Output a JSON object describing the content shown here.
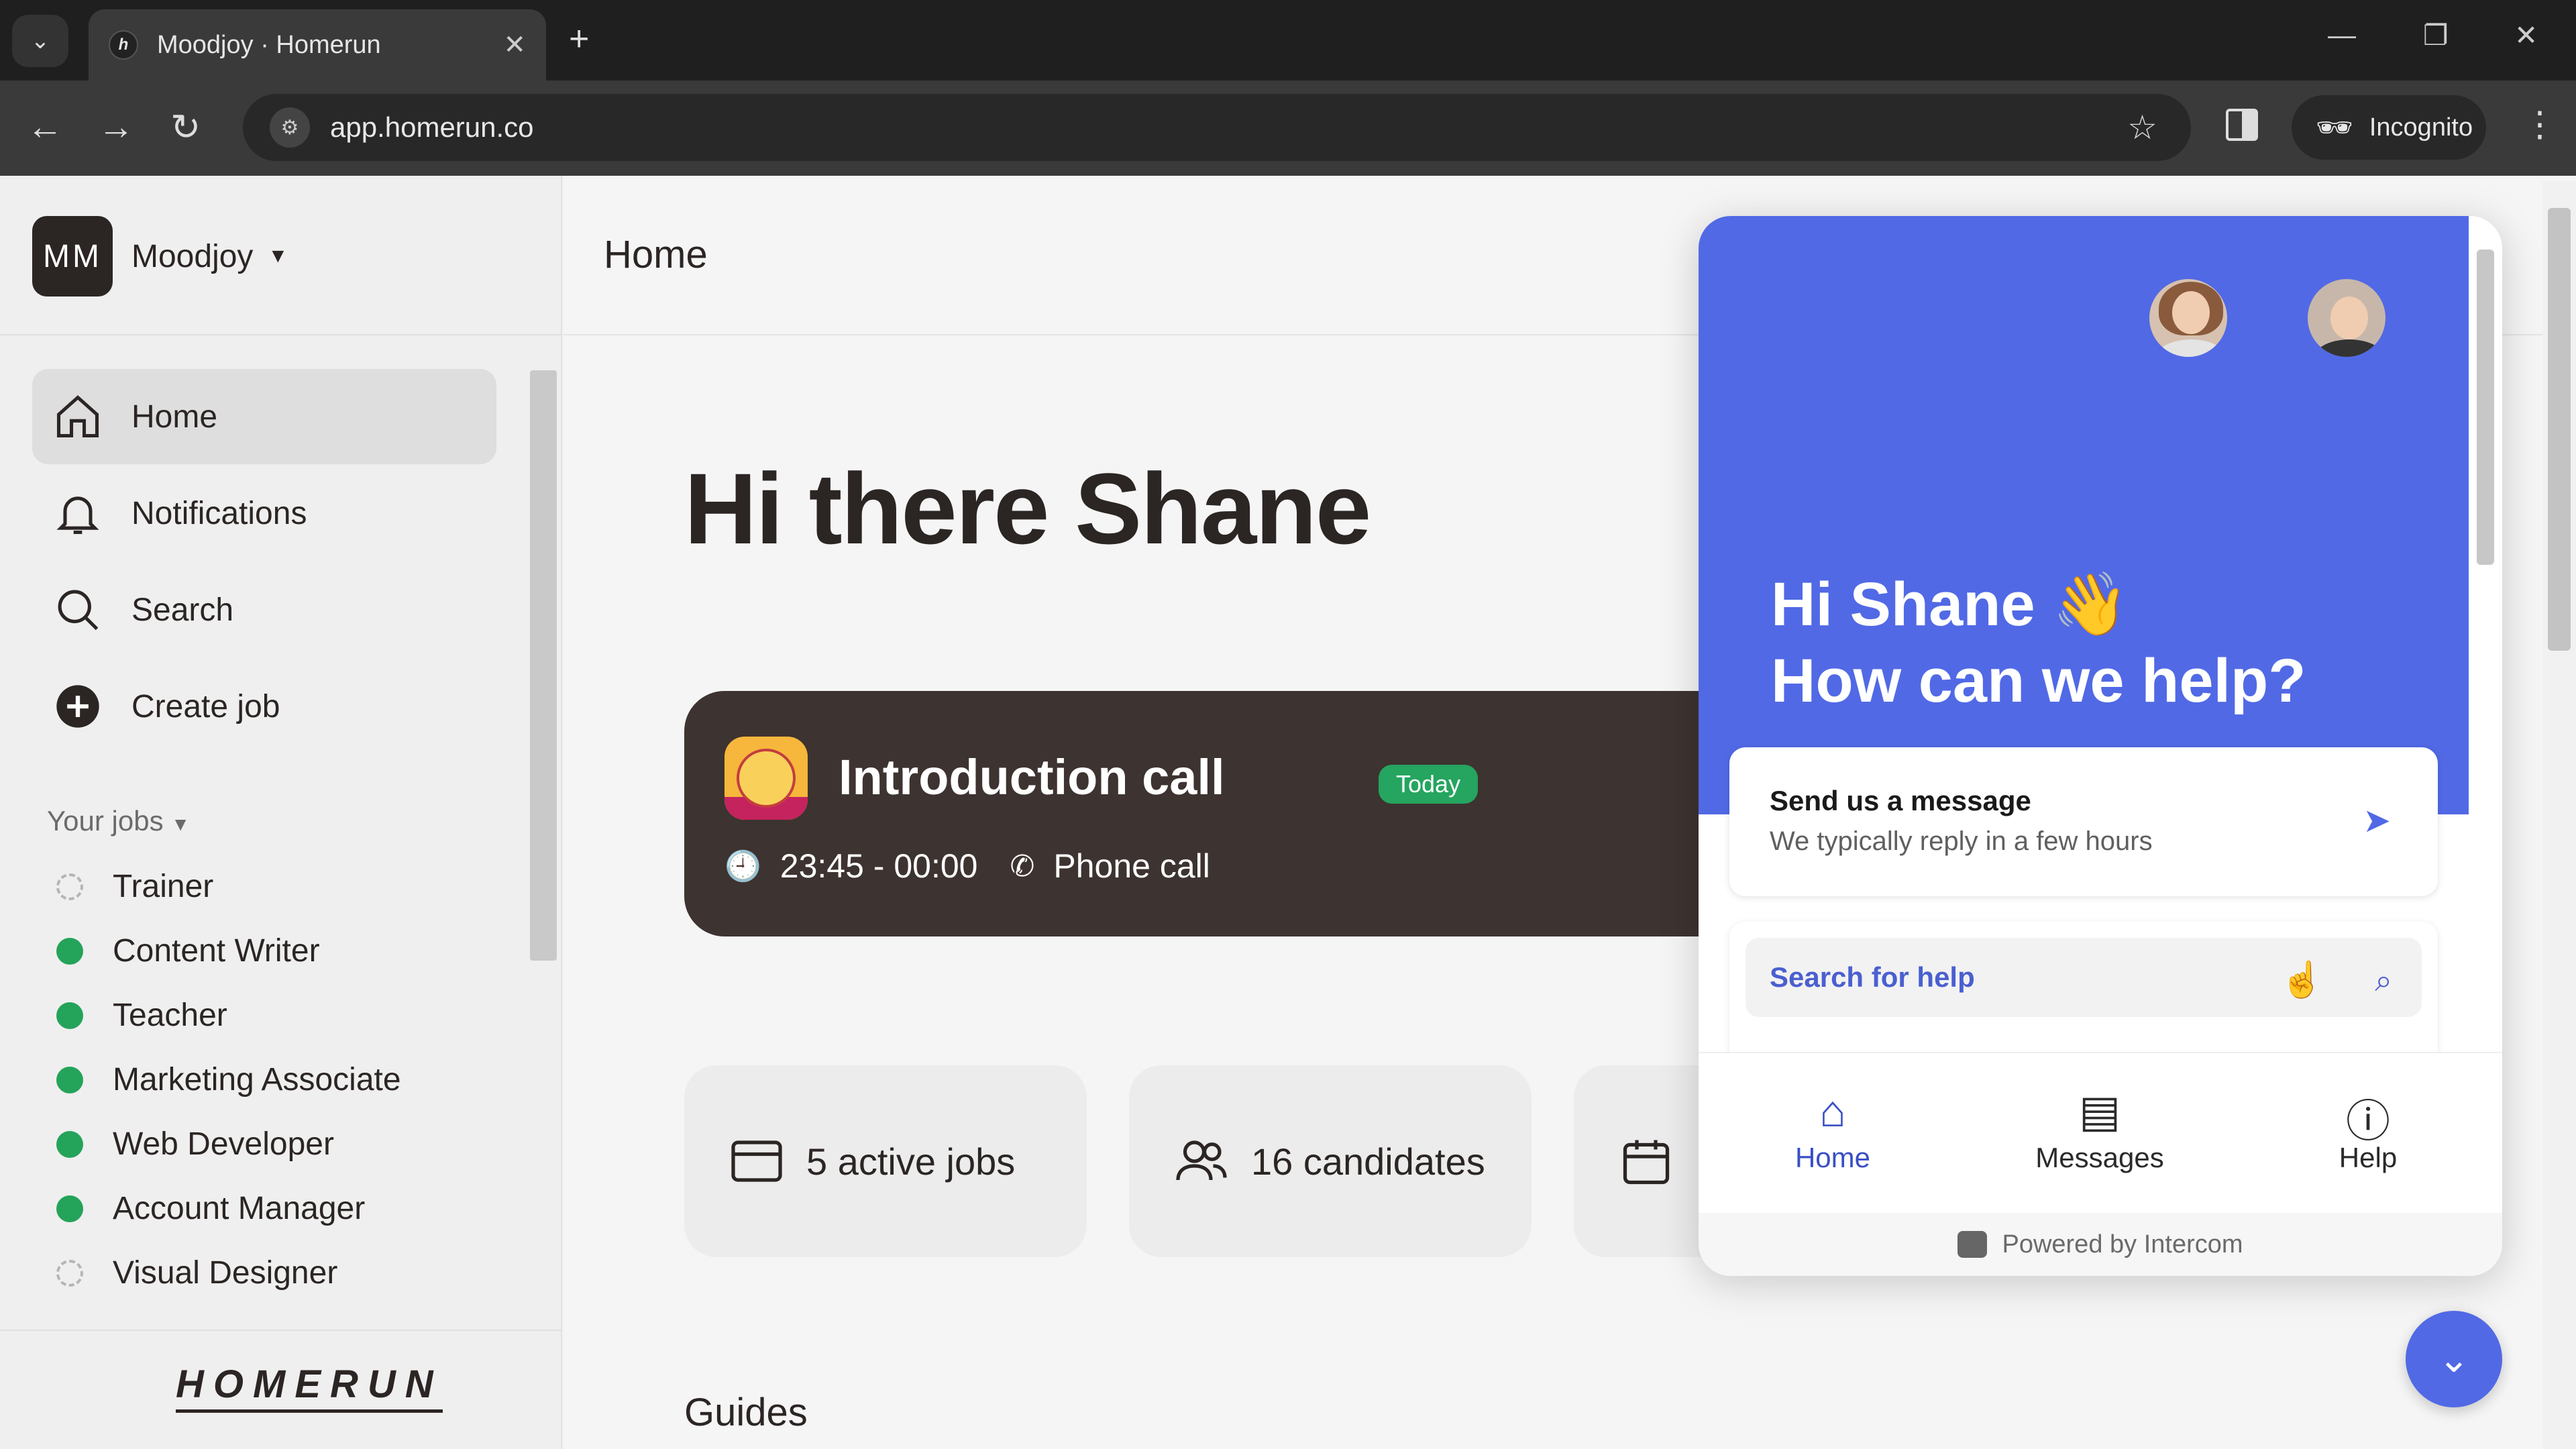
{
  "browser": {
    "tab_title": "Moodjoy · Homerun",
    "tab_close": "✕",
    "new_tab": "+",
    "url": "app.homerun.co",
    "incognito_label": "Incognito"
  },
  "sidebar": {
    "org_initials": "MM",
    "org_name": "Moodjoy",
    "nav": [
      {
        "label": "Home",
        "icon": "home-icon"
      },
      {
        "label": "Notifications",
        "icon": "bell-icon"
      },
      {
        "label": "Search",
        "icon": "search-icon"
      },
      {
        "label": "Create job",
        "icon": "plus-circle-icon"
      }
    ],
    "jobs_header": "Your jobs",
    "jobs": [
      {
        "title": "Trainer",
        "status": "draft"
      },
      {
        "title": "Content Writer",
        "status": "active"
      },
      {
        "title": "Teacher",
        "status": "active"
      },
      {
        "title": "Marketing Associate",
        "status": "active"
      },
      {
        "title": "Web Developer",
        "status": "active"
      },
      {
        "title": "Account Manager",
        "status": "active"
      },
      {
        "title": "Visual Designer",
        "status": "draft"
      }
    ],
    "logo_text": "HOMERUN"
  },
  "main": {
    "header": "Home",
    "greeting": "Hi there Shane",
    "event": {
      "title": "Introduction call",
      "badge": "Today",
      "time": "23:45 - 00:00",
      "type": "Phone call"
    },
    "stats": [
      {
        "label": "5 active jobs",
        "icon": "browser-window-icon"
      },
      {
        "label": "16 candidates",
        "icon": "people-icon"
      },
      {
        "label": "",
        "icon": "calendar-icon"
      }
    ],
    "guides_heading": "Guides"
  },
  "intercom": {
    "greeting_line1": "Hi Shane 👋",
    "greeting_line2": "How can we help?",
    "message_title": "Send us a message",
    "message_subtitle": "We typically reply in a few hours",
    "search_placeholder": "Search for help",
    "tabs": [
      {
        "label": "Home",
        "icon": "home-icon",
        "active": true
      },
      {
        "label": "Messages",
        "icon": "messages-icon",
        "active": false
      },
      {
        "label": "Help",
        "icon": "help-icon",
        "active": false
      }
    ],
    "footer": "Powered by Intercom",
    "accent_color": "#5169e5"
  },
  "colors": {
    "brand_dark": "#2b2523",
    "active_green": "#25a55f"
  }
}
